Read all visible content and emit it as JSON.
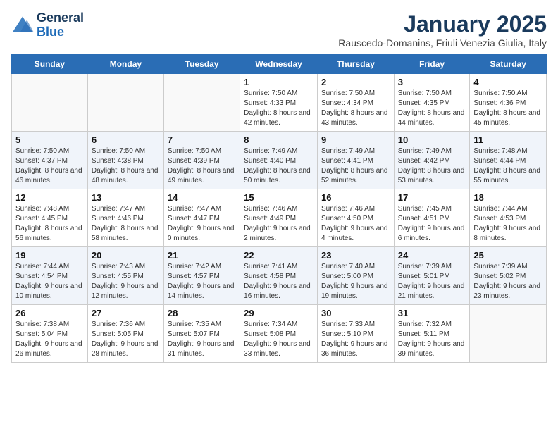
{
  "logo": {
    "line1": "General",
    "line2": "Blue"
  },
  "title": "January 2025",
  "subtitle": "Rauscedo-Domanins, Friuli Venezia Giulia, Italy",
  "weekdays": [
    "Sunday",
    "Monday",
    "Tuesday",
    "Wednesday",
    "Thursday",
    "Friday",
    "Saturday"
  ],
  "weeks": [
    [
      {
        "day": "",
        "sunrise": "",
        "sunset": "",
        "daylight": ""
      },
      {
        "day": "",
        "sunrise": "",
        "sunset": "",
        "daylight": ""
      },
      {
        "day": "",
        "sunrise": "",
        "sunset": "",
        "daylight": ""
      },
      {
        "day": "1",
        "sunrise": "Sunrise: 7:50 AM",
        "sunset": "Sunset: 4:33 PM",
        "daylight": "Daylight: 8 hours and 42 minutes."
      },
      {
        "day": "2",
        "sunrise": "Sunrise: 7:50 AM",
        "sunset": "Sunset: 4:34 PM",
        "daylight": "Daylight: 8 hours and 43 minutes."
      },
      {
        "day": "3",
        "sunrise": "Sunrise: 7:50 AM",
        "sunset": "Sunset: 4:35 PM",
        "daylight": "Daylight: 8 hours and 44 minutes."
      },
      {
        "day": "4",
        "sunrise": "Sunrise: 7:50 AM",
        "sunset": "Sunset: 4:36 PM",
        "daylight": "Daylight: 8 hours and 45 minutes."
      }
    ],
    [
      {
        "day": "5",
        "sunrise": "Sunrise: 7:50 AM",
        "sunset": "Sunset: 4:37 PM",
        "daylight": "Daylight: 8 hours and 46 minutes."
      },
      {
        "day": "6",
        "sunrise": "Sunrise: 7:50 AM",
        "sunset": "Sunset: 4:38 PM",
        "daylight": "Daylight: 8 hours and 48 minutes."
      },
      {
        "day": "7",
        "sunrise": "Sunrise: 7:50 AM",
        "sunset": "Sunset: 4:39 PM",
        "daylight": "Daylight: 8 hours and 49 minutes."
      },
      {
        "day": "8",
        "sunrise": "Sunrise: 7:49 AM",
        "sunset": "Sunset: 4:40 PM",
        "daylight": "Daylight: 8 hours and 50 minutes."
      },
      {
        "day": "9",
        "sunrise": "Sunrise: 7:49 AM",
        "sunset": "Sunset: 4:41 PM",
        "daylight": "Daylight: 8 hours and 52 minutes."
      },
      {
        "day": "10",
        "sunrise": "Sunrise: 7:49 AM",
        "sunset": "Sunset: 4:42 PM",
        "daylight": "Daylight: 8 hours and 53 minutes."
      },
      {
        "day": "11",
        "sunrise": "Sunrise: 7:48 AM",
        "sunset": "Sunset: 4:44 PM",
        "daylight": "Daylight: 8 hours and 55 minutes."
      }
    ],
    [
      {
        "day": "12",
        "sunrise": "Sunrise: 7:48 AM",
        "sunset": "Sunset: 4:45 PM",
        "daylight": "Daylight: 8 hours and 56 minutes."
      },
      {
        "day": "13",
        "sunrise": "Sunrise: 7:47 AM",
        "sunset": "Sunset: 4:46 PM",
        "daylight": "Daylight: 8 hours and 58 minutes."
      },
      {
        "day": "14",
        "sunrise": "Sunrise: 7:47 AM",
        "sunset": "Sunset: 4:47 PM",
        "daylight": "Daylight: 9 hours and 0 minutes."
      },
      {
        "day": "15",
        "sunrise": "Sunrise: 7:46 AM",
        "sunset": "Sunset: 4:49 PM",
        "daylight": "Daylight: 9 hours and 2 minutes."
      },
      {
        "day": "16",
        "sunrise": "Sunrise: 7:46 AM",
        "sunset": "Sunset: 4:50 PM",
        "daylight": "Daylight: 9 hours and 4 minutes."
      },
      {
        "day": "17",
        "sunrise": "Sunrise: 7:45 AM",
        "sunset": "Sunset: 4:51 PM",
        "daylight": "Daylight: 9 hours and 6 minutes."
      },
      {
        "day": "18",
        "sunrise": "Sunrise: 7:44 AM",
        "sunset": "Sunset: 4:53 PM",
        "daylight": "Daylight: 9 hours and 8 minutes."
      }
    ],
    [
      {
        "day": "19",
        "sunrise": "Sunrise: 7:44 AM",
        "sunset": "Sunset: 4:54 PM",
        "daylight": "Daylight: 9 hours and 10 minutes."
      },
      {
        "day": "20",
        "sunrise": "Sunrise: 7:43 AM",
        "sunset": "Sunset: 4:55 PM",
        "daylight": "Daylight: 9 hours and 12 minutes."
      },
      {
        "day": "21",
        "sunrise": "Sunrise: 7:42 AM",
        "sunset": "Sunset: 4:57 PM",
        "daylight": "Daylight: 9 hours and 14 minutes."
      },
      {
        "day": "22",
        "sunrise": "Sunrise: 7:41 AM",
        "sunset": "Sunset: 4:58 PM",
        "daylight": "Daylight: 9 hours and 16 minutes."
      },
      {
        "day": "23",
        "sunrise": "Sunrise: 7:40 AM",
        "sunset": "Sunset: 5:00 PM",
        "daylight": "Daylight: 9 hours and 19 minutes."
      },
      {
        "day": "24",
        "sunrise": "Sunrise: 7:39 AM",
        "sunset": "Sunset: 5:01 PM",
        "daylight": "Daylight: 9 hours and 21 minutes."
      },
      {
        "day": "25",
        "sunrise": "Sunrise: 7:39 AM",
        "sunset": "Sunset: 5:02 PM",
        "daylight": "Daylight: 9 hours and 23 minutes."
      }
    ],
    [
      {
        "day": "26",
        "sunrise": "Sunrise: 7:38 AM",
        "sunset": "Sunset: 5:04 PM",
        "daylight": "Daylight: 9 hours and 26 minutes."
      },
      {
        "day": "27",
        "sunrise": "Sunrise: 7:36 AM",
        "sunset": "Sunset: 5:05 PM",
        "daylight": "Daylight: 9 hours and 28 minutes."
      },
      {
        "day": "28",
        "sunrise": "Sunrise: 7:35 AM",
        "sunset": "Sunset: 5:07 PM",
        "daylight": "Daylight: 9 hours and 31 minutes."
      },
      {
        "day": "29",
        "sunrise": "Sunrise: 7:34 AM",
        "sunset": "Sunset: 5:08 PM",
        "daylight": "Daylight: 9 hours and 33 minutes."
      },
      {
        "day": "30",
        "sunrise": "Sunrise: 7:33 AM",
        "sunset": "Sunset: 5:10 PM",
        "daylight": "Daylight: 9 hours and 36 minutes."
      },
      {
        "day": "31",
        "sunrise": "Sunrise: 7:32 AM",
        "sunset": "Sunset: 5:11 PM",
        "daylight": "Daylight: 9 hours and 39 minutes."
      },
      {
        "day": "",
        "sunrise": "",
        "sunset": "",
        "daylight": ""
      }
    ]
  ]
}
